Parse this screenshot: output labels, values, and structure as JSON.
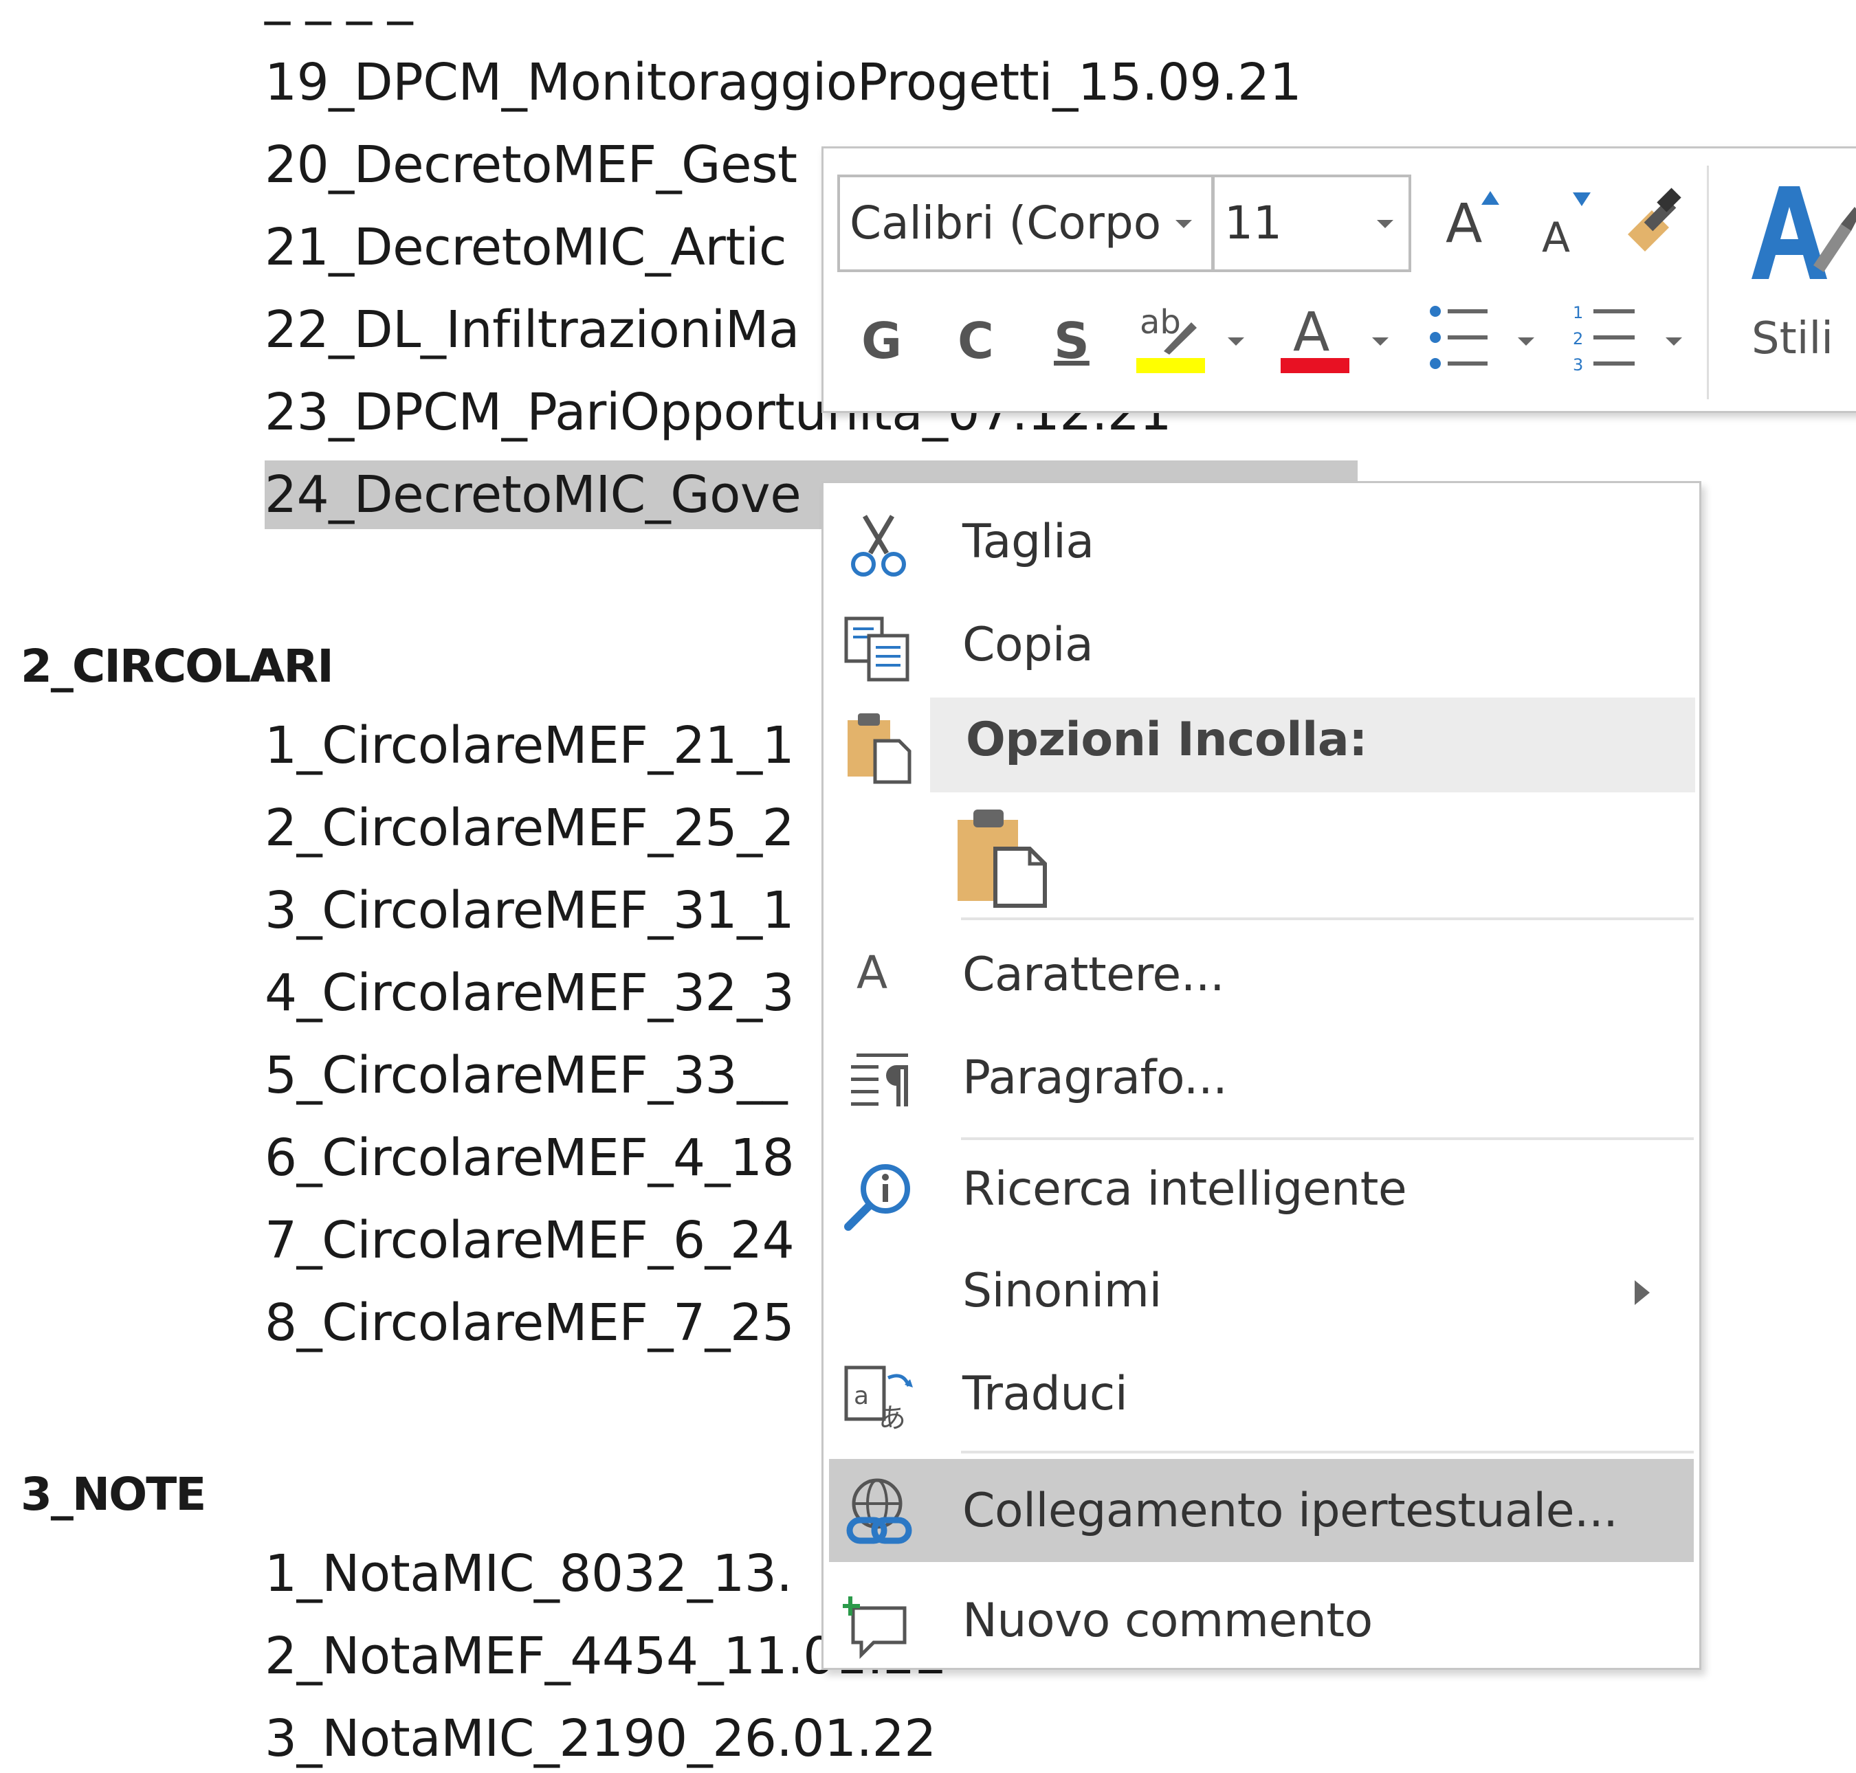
{
  "document": {
    "partial_top_line": "_  _               _  _",
    "lines_top": [
      "19_DPCM_MonitoraggioProgetti_15.09.21",
      "20_DecretoMEF_Gest",
      "21_DecretoMIC_Artic",
      "22_DL_InfiltrazioniMa",
      "23_DPCM_PariOpportunita_07.12.21",
      "24_DecretoMIC_Gove"
    ],
    "heading_circolari": "2_CIRCOLARI",
    "lines_circolari": [
      "1_CircolareMEF_21_1",
      "2_CircolareMEF_25_2",
      "3_CircolareMEF_31_1",
      "4_CircolareMEF_32_3",
      "5_CircolareMEF_33__",
      "6_CircolareMEF_4_18",
      "7_CircolareMEF_6_24",
      "8_CircolareMEF_7_25"
    ],
    "heading_note": "3_NOTE",
    "lines_note": [
      "1_NotaMIC_8032_13.",
      "2_NotaMEF_4454_11.01.22",
      "3_NotaMIC_2190_26.01.22"
    ]
  },
  "toolbar": {
    "font_name": "Calibri (Corpo",
    "font_size": "11",
    "bold": "G",
    "italic": "C",
    "underline": "S",
    "highlight_glyph": "ab",
    "font_color_glyph": "A",
    "grow_glyph": "A",
    "shrink_glyph": "A",
    "styles_label": "Stili",
    "colors": {
      "highlight": "#ffff00",
      "font_color": "#e81123",
      "accent": "#2b78c5",
      "brush": "#e3b36b"
    }
  },
  "context_menu": {
    "cut": "Taglia",
    "copy": "Copia",
    "paste_options": "Opzioni Incolla:",
    "font": "Carattere...",
    "font_icon_glyph": "A",
    "paragraph": "Paragrafo...",
    "smart_lookup": "Ricerca intelligente",
    "synonyms": "Sinonimi",
    "translate": "Traduci",
    "hyperlink": "Collegamento ipertestuale...",
    "new_comment": "Nuovo commento"
  }
}
